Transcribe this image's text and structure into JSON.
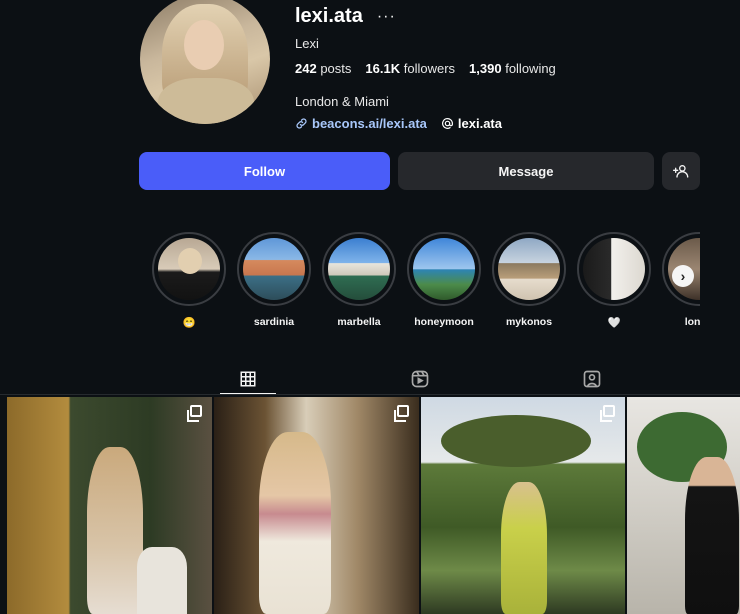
{
  "profile": {
    "username": "lexi.ata",
    "more": "···",
    "display_name": "Lexi",
    "posts_count": "242",
    "posts_label": "posts",
    "followers_count": "16.1K",
    "followers_label": "followers",
    "following_count": "1,390",
    "following_label": "following",
    "bio": "London & Miami",
    "link": "beacons.ai/lexi.ata",
    "threads_handle": "lexi.ata"
  },
  "actions": {
    "follow": "Follow",
    "message": "Message"
  },
  "highlights": [
    {
      "label": "😁"
    },
    {
      "label": "sardinia"
    },
    {
      "label": "marbella"
    },
    {
      "label": "honeymoon"
    },
    {
      "label": "mykonos"
    },
    {
      "label": "🤍"
    },
    {
      "label": "londo"
    }
  ],
  "colors": {
    "background": "#0c1014",
    "follow_button": "#4a5df9",
    "secondary_button": "#26282c",
    "link": "#a8c7fa"
  },
  "icons": {
    "tab_posts": "grid-icon",
    "tab_reels": "reels-icon",
    "tab_tagged": "tagged-icon",
    "carousel": "multi-photo-icon"
  }
}
